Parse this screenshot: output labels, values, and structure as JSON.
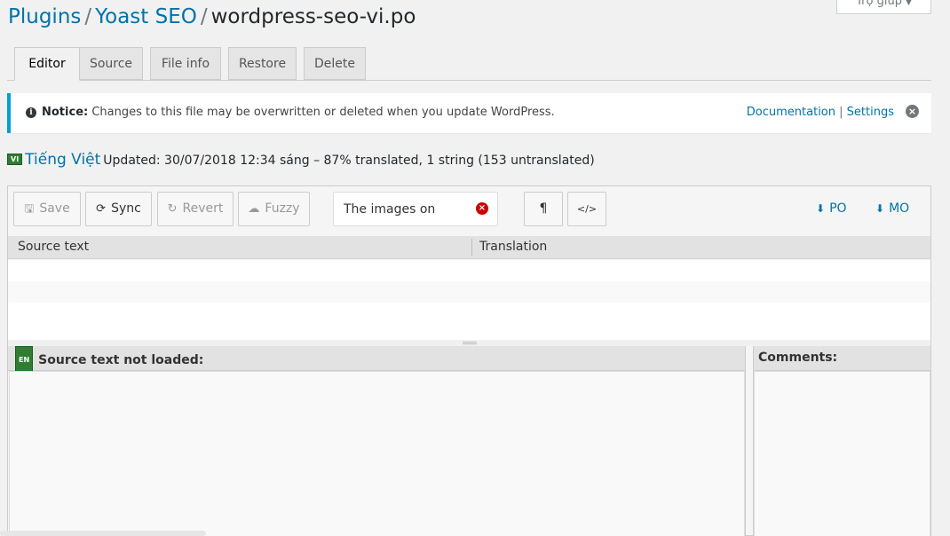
{
  "help": {
    "label": "Trợ giúp",
    "caret": "▼"
  },
  "breadcrumb": {
    "plugins": "Plugins",
    "sep": "/",
    "plugin": "Yoast SEO",
    "file": "wordpress-seo-vi.po"
  },
  "tabs": [
    {
      "label": "Editor"
    },
    {
      "label": "Source"
    },
    {
      "label": "File info"
    },
    {
      "label": "Restore"
    },
    {
      "label": "Delete"
    }
  ],
  "notice": {
    "label": "Notice:",
    "text": "Changes to this file may be overwritten or deleted when you update WordPress.",
    "documentation": "Documentation",
    "pipe": "|",
    "settings": "Settings"
  },
  "locale": {
    "flag": "VI",
    "name": "Tiếng Việt",
    "status": "Updated: 30/07/2018 12:34 sáng – 87% translated, 1 string (153 untranslated)"
  },
  "toolbar": {
    "save": "Save",
    "sync": "Sync",
    "revert": "Revert",
    "fuzzy": "Fuzzy",
    "search_value": "The images on",
    "pilcrow": "¶",
    "code": "</>",
    "po": "PO",
    "mo": "MO"
  },
  "grid": {
    "source_header": "Source text",
    "translation_header": "Translation"
  },
  "source_pane": {
    "flag": "EN",
    "title": "Source text not loaded:"
  },
  "comments_pane": {
    "title": "Comments:"
  },
  "colors": {
    "link": "#0073aa",
    "notice_border": "#00a0d2",
    "flag_green": "#2e7d32"
  }
}
